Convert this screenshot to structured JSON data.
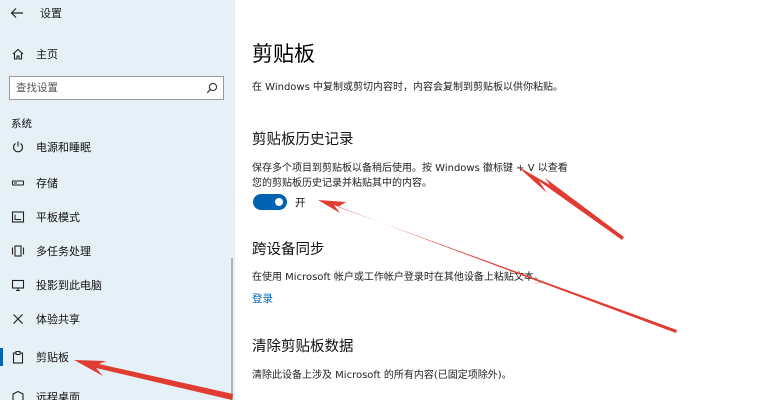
{
  "window": {
    "title": "设置"
  },
  "sidebar": {
    "home_label": "主页",
    "search_placeholder": "查找设置",
    "section_label": "系统",
    "items": [
      {
        "label": "电源和睡眠",
        "icon": "power-icon"
      },
      {
        "label": "存储",
        "icon": "storage-icon"
      },
      {
        "label": "平板模式",
        "icon": "tablet-mode-icon"
      },
      {
        "label": "多任务处理",
        "icon": "multitasking-icon"
      },
      {
        "label": "投影到此电脑",
        "icon": "project-icon"
      },
      {
        "label": "体验共享",
        "icon": "shared-experiences-icon"
      },
      {
        "label": "剪贴板",
        "icon": "clipboard-icon",
        "active": true
      },
      {
        "label": "远程桌面",
        "icon": "remote-desktop-icon"
      }
    ]
  },
  "main": {
    "title": "剪贴板",
    "intro": "在 Windows 中复制或剪切内容时，内容会复制到剪贴板以供你粘贴。",
    "history": {
      "heading": "剪贴板历史记录",
      "desc_line1": "保存多个项目到剪贴板以备稍后使用。按 Windows 徽标键 + V 以查看",
      "desc_line2": "您的剪贴板历史记录并粘贴其中的内容。",
      "toggle_label": "开"
    },
    "sync": {
      "heading": "跨设备同步",
      "desc": "在使用 Microsoft 帐户或工作帐户登录时在其他设备上粘贴文本。",
      "link": "登录"
    },
    "clear": {
      "heading": "清除剪贴板数据",
      "desc": "清除此设备上涉及 Microsoft 的所有内容(已固定项除外)。"
    }
  },
  "colors": {
    "accent": "#0063b1",
    "link": "#0066b4",
    "sidebar_bg": "#e6f0f7",
    "annotation": "#e03c31"
  }
}
